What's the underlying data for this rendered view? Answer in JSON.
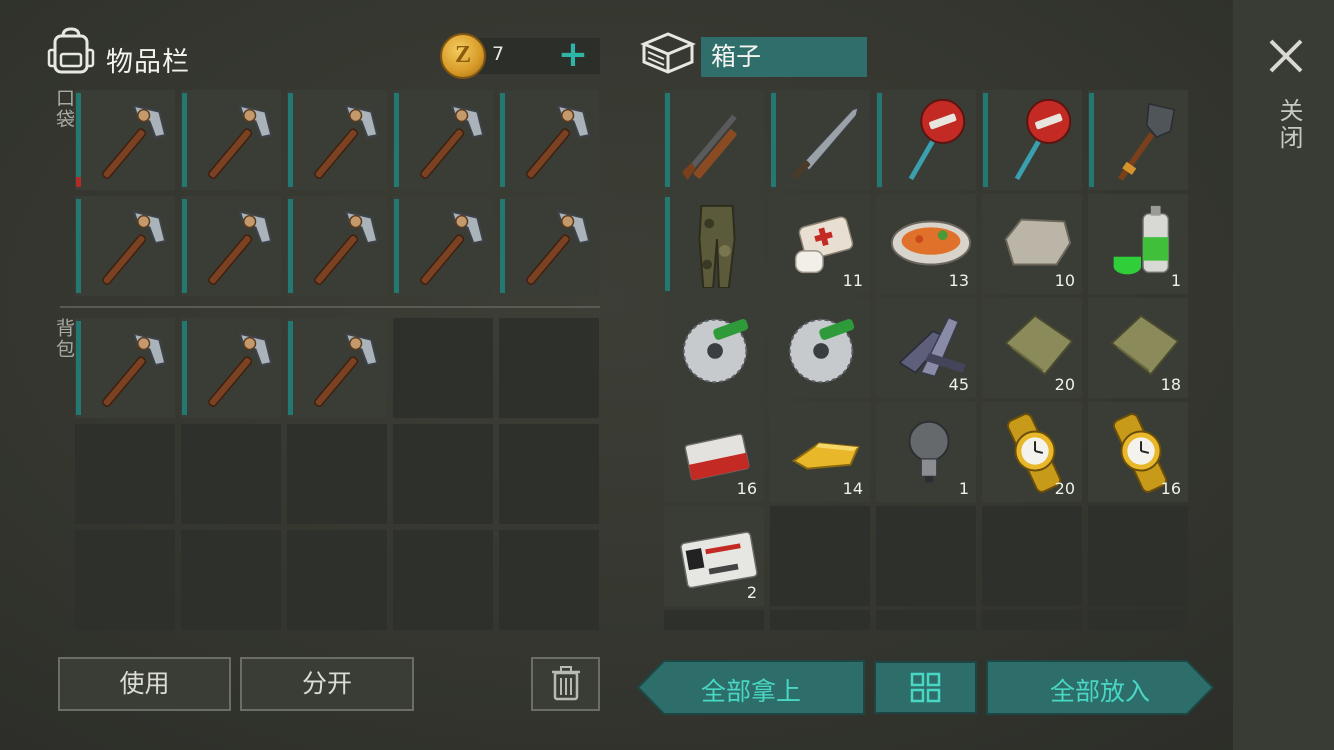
{
  "inventory": {
    "title": "物品栏",
    "coins": "7",
    "pocket_label": "口袋",
    "backpack_label": "背包",
    "pocket_slots": [
      {
        "item": "pickaxe",
        "durability_warning": true
      },
      {
        "item": "pickaxe"
      },
      {
        "item": "pickaxe"
      },
      {
        "item": "pickaxe"
      },
      {
        "item": "pickaxe"
      },
      {
        "item": "pickaxe"
      },
      {
        "item": "pickaxe"
      },
      {
        "item": "pickaxe"
      },
      {
        "item": "pickaxe"
      },
      {
        "item": "pickaxe"
      }
    ],
    "backpack_slots": [
      {
        "item": "pickaxe"
      },
      {
        "item": "pickaxe"
      },
      {
        "item": "pickaxe"
      },
      {},
      {},
      {},
      {},
      {},
      {},
      {},
      {},
      {},
      {},
      {},
      {}
    ],
    "use_label": "使用",
    "split_label": "分开"
  },
  "box": {
    "title": "箱子",
    "slots": [
      {
        "item": "rifle",
        "qty": ""
      },
      {
        "item": "machete",
        "qty": ""
      },
      {
        "item": "stop-sign-axe",
        "qty": ""
      },
      {
        "item": "stop-sign-axe",
        "qty": ""
      },
      {
        "item": "shovel",
        "qty": ""
      },
      {
        "item": "camo-pants",
        "qty": ""
      },
      {
        "item": "bandage",
        "qty": "11"
      },
      {
        "item": "food-plate",
        "qty": "13"
      },
      {
        "item": "stone",
        "qty": "10"
      },
      {
        "item": "spray-paint",
        "qty": "1"
      },
      {
        "item": "saw-blade",
        "qty": ""
      },
      {
        "item": "saw-blade",
        "qty": ""
      },
      {
        "item": "scrap-metal",
        "qty": "45"
      },
      {
        "item": "cloth",
        "qty": "20"
      },
      {
        "item": "cloth",
        "qty": "18"
      },
      {
        "item": "cigarettes",
        "qty": "16"
      },
      {
        "item": "gold-bar",
        "qty": "14"
      },
      {
        "item": "light-bulb",
        "qty": "1"
      },
      {
        "item": "gold-watch",
        "qty": "20"
      },
      {
        "item": "gold-watch",
        "qty": "16"
      },
      {
        "item": "army-id-card",
        "qty": "2"
      },
      {},
      {},
      {},
      {}
    ],
    "take_all_label": "全部拿上",
    "put_all_label": "全部放入"
  },
  "close_label": "关闭",
  "colors": {
    "accent": "#2fb5a8",
    "durability_bar": "#237872",
    "warning": "#b22b24"
  }
}
